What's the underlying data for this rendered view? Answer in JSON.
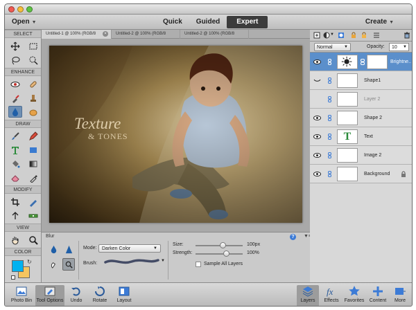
{
  "menubar": {
    "open_label": "Open",
    "create_label": "Create",
    "modes": [
      "Quick",
      "Guided",
      "Expert"
    ],
    "active_mode": "Expert"
  },
  "toolbar": {
    "sections": {
      "select": "SELECT",
      "enhance": "ENHANCE",
      "draw": "DRAW",
      "modify": "MODIFY",
      "view": "VIEW",
      "color": "COLOR"
    },
    "foreground_color": "#00b2f0",
    "background_color": "#f6c55f"
  },
  "tabs": [
    "Untitled-1 @ 100% (RGB/8",
    "Untitled-2 @ 100% (RGB/8",
    "Untitled-2 @ 100% (RGB/8"
  ],
  "canvas": {
    "watermark_line1": "Texture",
    "watermark_line2": "& TONES"
  },
  "tool_options": {
    "title": "Blur",
    "mode_label": "Mode:",
    "mode_value": "Darken Color",
    "brush_label": "Brush:",
    "size_label": "Size:",
    "size_value": "100px",
    "size_fraction": 0.58,
    "strength_label": "Strength:",
    "strength_value": "100%",
    "strength_fraction": 0.64,
    "sample_all_label": "Sample All Layers"
  },
  "layers_panel": {
    "blend_mode": "Normal",
    "opacity_label": "Opacity:",
    "opacity_value": "10",
    "layers": [
      {
        "name": "Brightne..",
        "selected": true,
        "adjustment": true
      },
      {
        "name": "Shape1"
      },
      {
        "name": "Layer 2",
        "dim": true
      },
      {
        "name": "Shape 2"
      },
      {
        "name": "Text",
        "text_layer": true,
        "thumb_glyph": "T"
      },
      {
        "name": "Image 2"
      },
      {
        "name": "Background",
        "locked": true
      }
    ]
  },
  "bottombar": {
    "photo_bin": "Photo Bin",
    "tool_options": "Tool Options",
    "undo": "Undo",
    "rotate": "Rotate",
    "layout": "Layout",
    "layers": "Layers",
    "effects": "Effects",
    "favorites": "Favorites",
    "content": "Content",
    "more": "More"
  }
}
